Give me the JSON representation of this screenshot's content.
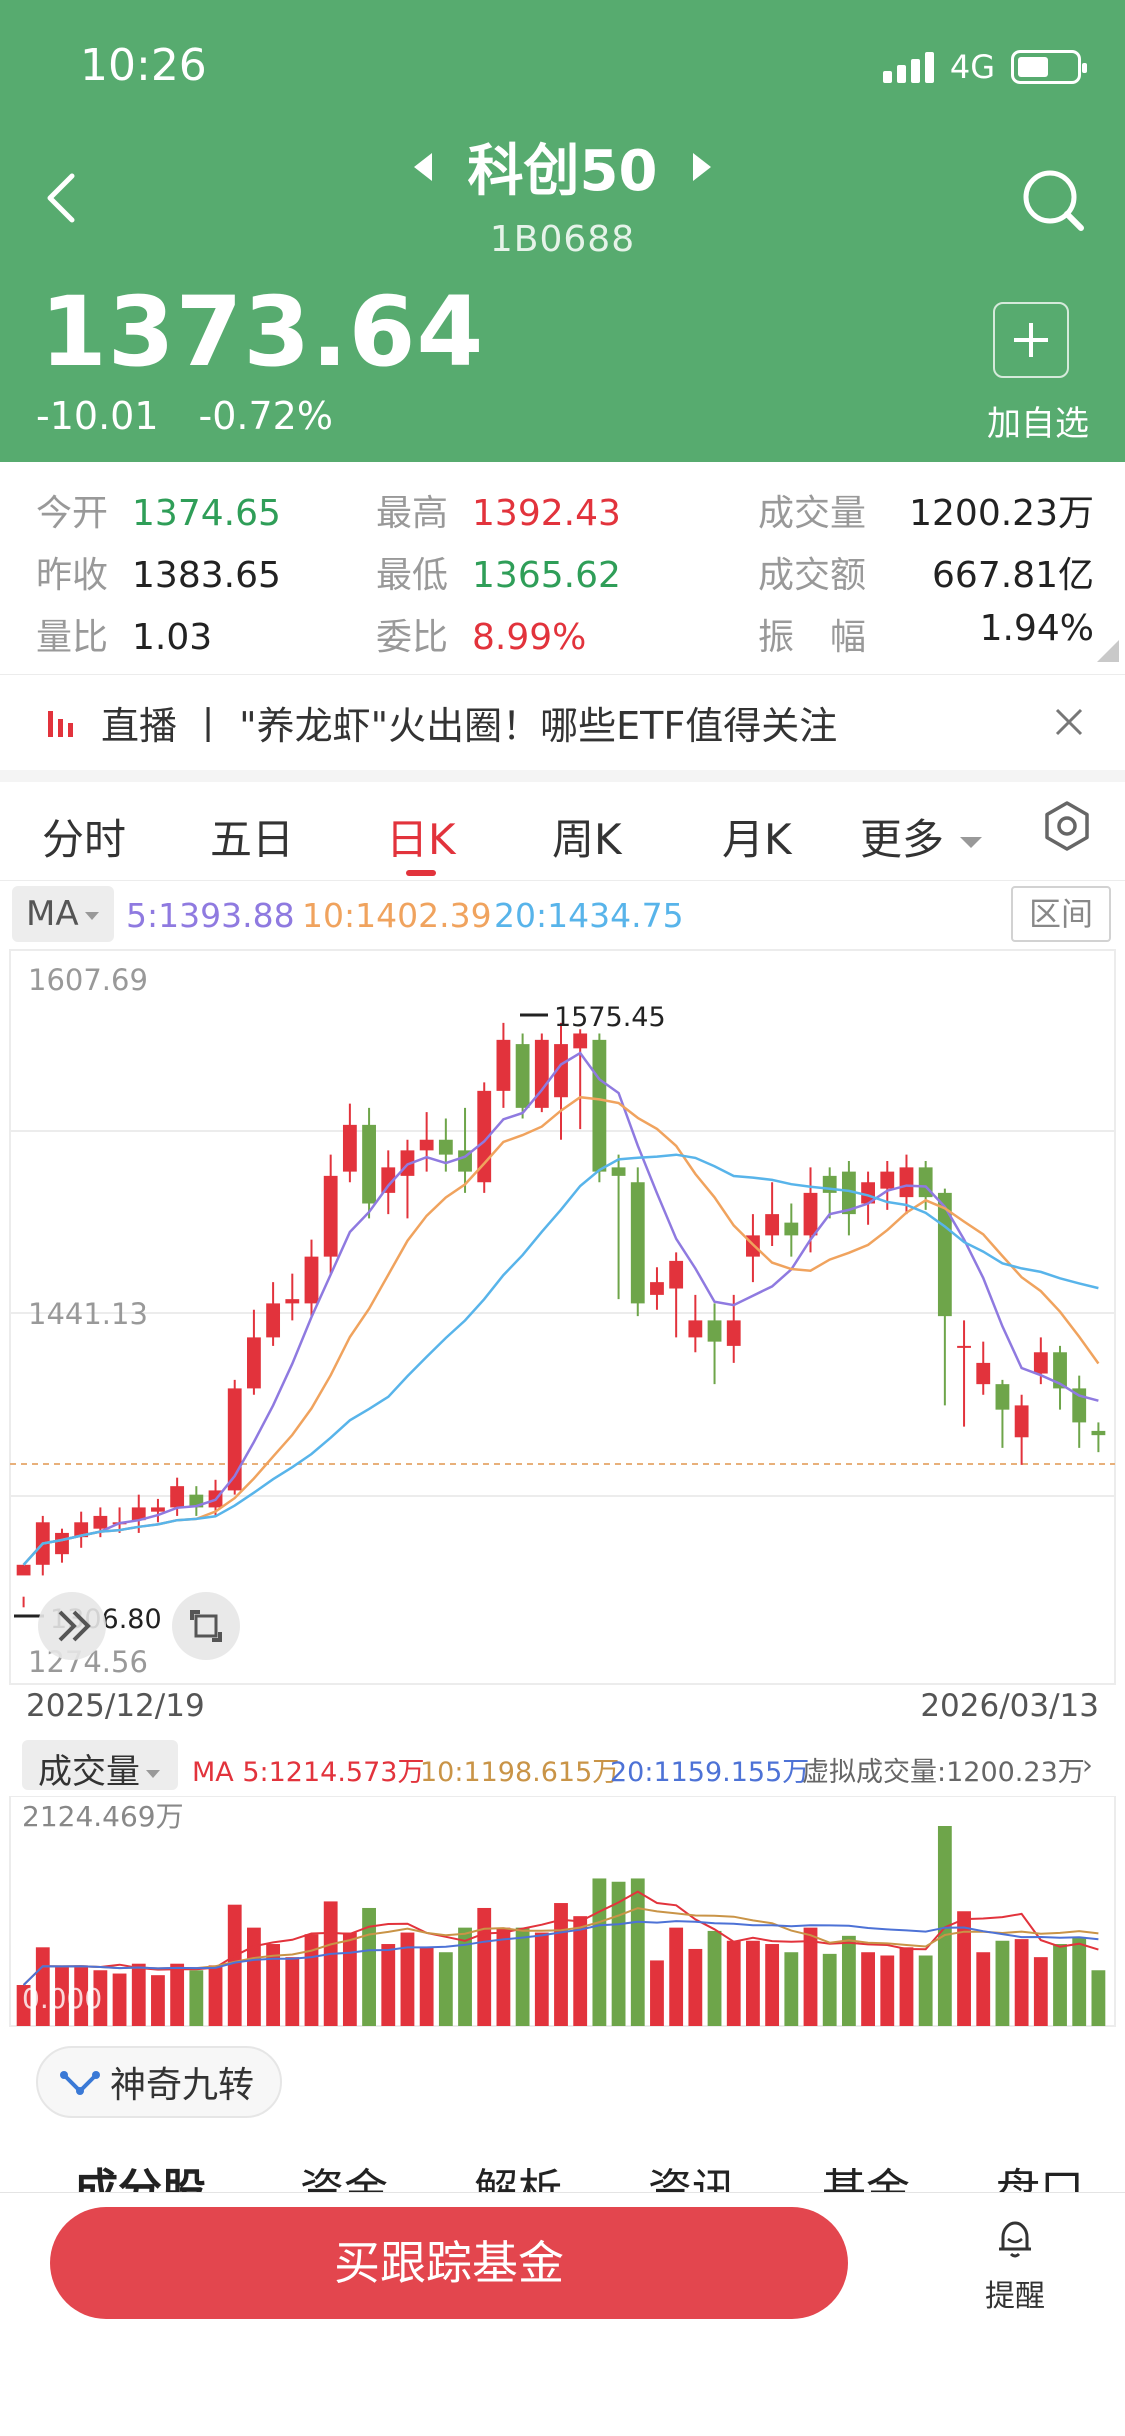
{
  "status": {
    "time": "10:26",
    "network": "4G"
  },
  "header": {
    "title": "科创50",
    "code": "1B0688",
    "price": "1373.64",
    "change": "-10.01",
    "change_pct": "-0.72%",
    "add_label": "加自选",
    "bg_color": "#57ab6f"
  },
  "stats": {
    "open_label": "今开",
    "open": "1374.65",
    "prev_label": "昨收",
    "prev": "1383.65",
    "vr_label": "量比",
    "vr": "1.03",
    "high_label": "最高",
    "high": "1392.43",
    "low_label": "最低",
    "low": "1365.62",
    "wb_label": "委比",
    "wb": "8.99%",
    "vol_label": "成交量",
    "vol": "1200.23万",
    "amt_label": "成交额",
    "amt": "667.81亿",
    "amp_label": "振　幅",
    "amp": "1.94%"
  },
  "banner": {
    "text": "直播 丨 \"养龙虾\"火出圈！哪些ETF值得关注"
  },
  "tabs": [
    {
      "label": "分时"
    },
    {
      "label": "五日"
    },
    {
      "label": "日K"
    },
    {
      "label": "周K"
    },
    {
      "label": "月K"
    },
    {
      "label": "更多"
    }
  ],
  "active_tab": "日K",
  "ma": {
    "selector": "MA",
    "ma5": "5:1393.88",
    "ma10": "10:1402.39",
    "ma20": "20:1434.75",
    "range_label": "区间",
    "colors": {
      "ma5": "#8f7ae0",
      "ma10": "#f0a35e",
      "ma20": "#58b4ea"
    }
  },
  "kline": {
    "y_top_label": "1607.69",
    "y_mid_label": "1441.13",
    "y_bottom_label": "1274.56",
    "max_label": "1575.45",
    "min_label": "1306.80",
    "date_start": "2025/12/19",
    "date_end": "2026/03/13",
    "up_color": "#e2333c",
    "down_color": "#6ea54a"
  },
  "volume": {
    "selector": "成交量",
    "ma5": "MA 5:1214.573万",
    "ma10": "10:1198.615万",
    "ma20": "20:1159.155万",
    "virtual": "虚拟成交量:1200.23万",
    "y_top_label": "2124.469万",
    "y_bottom_label": "0.000"
  },
  "nine_turn": {
    "label": "神奇九转"
  },
  "bottom_tabs": [
    {
      "label": "成分股"
    },
    {
      "label": "资金"
    },
    {
      "label": "解析"
    },
    {
      "label": "资讯"
    },
    {
      "label": "基金"
    },
    {
      "label": "盘口"
    }
  ],
  "footer": {
    "buy_label": "买跟踪基金",
    "remind_label": "提醒"
  },
  "chart_data": {
    "type": "candlestick",
    "y_range": [
      1274.56,
      1607.69
    ],
    "y_ticks": [
      1607.69,
      1441.13,
      1274.56
    ],
    "x_range": [
      "2025/12/19",
      "2026/03/13"
    ],
    "ohlc": [
      [
        1320,
        1325,
        1310,
        1305
      ],
      [
        1325,
        1345,
        1348,
        1320
      ],
      [
        1330,
        1340,
        1342,
        1326
      ],
      [
        1338,
        1345,
        1350,
        1333
      ],
      [
        1342,
        1348,
        1352,
        1338
      ],
      [
        1345,
        1345,
        1352,
        1340
      ],
      [
        1346,
        1352,
        1358,
        1340
      ],
      [
        1350,
        1352,
        1356,
        1345
      ],
      [
        1352,
        1362,
        1366,
        1348
      ],
      [
        1358,
        1352,
        1362,
        1348
      ],
      [
        1352,
        1360,
        1365,
        1348
      ],
      [
        1360,
        1408,
        1412,
        1358
      ],
      [
        1408,
        1432,
        1445,
        1405
      ],
      [
        1432,
        1448,
        1458,
        1428
      ],
      [
        1448,
        1450,
        1462,
        1440
      ],
      [
        1448,
        1470,
        1478,
        1442
      ],
      [
        1470,
        1508,
        1518,
        1462
      ],
      [
        1510,
        1532,
        1542,
        1505
      ],
      [
        1532,
        1495,
        1540,
        1488
      ],
      [
        1500,
        1512,
        1520,
        1490
      ],
      [
        1508,
        1520,
        1525,
        1488
      ],
      [
        1520,
        1525,
        1538,
        1510
      ],
      [
        1525,
        1518,
        1535,
        1510
      ],
      [
        1520,
        1510,
        1540,
        1500
      ],
      [
        1505,
        1548,
        1552,
        1500
      ],
      [
        1548,
        1572,
        1580,
        1540
      ],
      [
        1570,
        1540,
        1575,
        1535
      ],
      [
        1540,
        1572,
        1575,
        1538
      ],
      [
        1545,
        1570,
        1580,
        1525
      ],
      [
        1568,
        1575,
        1577,
        1530
      ],
      [
        1572,
        1510,
        1575,
        1505
      ],
      [
        1512,
        1508,
        1518,
        1450
      ],
      [
        1505,
        1448,
        1512,
        1442
      ],
      [
        1452,
        1458,
        1465,
        1445
      ],
      [
        1455,
        1468,
        1472,
        1432
      ],
      [
        1432,
        1440,
        1452,
        1425
      ],
      [
        1440,
        1430,
        1448,
        1410
      ],
      [
        1428,
        1440,
        1452,
        1420
      ],
      [
        1470,
        1480,
        1490,
        1458
      ],
      [
        1480,
        1490,
        1505,
        1475
      ],
      [
        1486,
        1480,
        1495,
        1470
      ],
      [
        1480,
        1500,
        1512,
        1472
      ],
      [
        1508,
        1500,
        1512,
        1488
      ],
      [
        1510,
        1490,
        1515,
        1480
      ],
      [
        1495,
        1505,
        1510,
        1485
      ],
      [
        1502,
        1510,
        1515,
        1492
      ],
      [
        1498,
        1512,
        1518,
        1490
      ],
      [
        1512,
        1498,
        1515,
        1492
      ],
      [
        1500,
        1442,
        1502,
        1400
      ],
      [
        1428,
        1428,
        1440,
        1390
      ],
      [
        1410,
        1420,
        1430,
        1405
      ],
      [
        1410,
        1398,
        1412,
        1380
      ],
      [
        1385,
        1400,
        1405,
        1372
      ],
      [
        1415,
        1425,
        1432,
        1410
      ],
      [
        1425,
        1408,
        1428,
        1398
      ],
      [
        1408,
        1392,
        1414,
        1380
      ],
      [
        1388,
        1386,
        1392,
        1378
      ]
    ],
    "volume_series_ma": [
      "MA5",
      "MA10",
      "MA20"
    ]
  }
}
